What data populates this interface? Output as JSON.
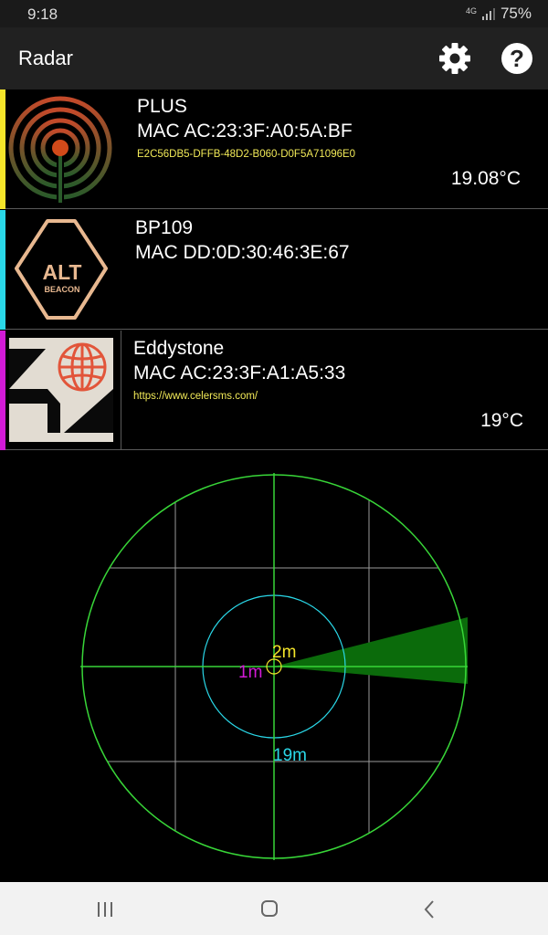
{
  "status": {
    "time": "9:18",
    "network": "4G",
    "battery": "75%"
  },
  "appbar": {
    "title": "Radar",
    "settings_icon": "gear-icon",
    "help_icon": "help-icon"
  },
  "devices": [
    {
      "name": "PLUS",
      "mac": "MAC AC:23:3F:A0:5A:BF",
      "uuid": "E2C56DB5-DFFB-48D2-B060-D0F5A71096E0",
      "temp": "19.08°C",
      "accent": "#f5e52a",
      "logo": "broadcast-beacon-logo"
    },
    {
      "name": "BP109",
      "mac": "MAC DD:0D:30:46:3E:67",
      "accent": "#2ad8e8",
      "logo": "altbeacon-logo",
      "logo_text": "ALT",
      "logo_subtext": "BEACON"
    },
    {
      "name": "Eddystone",
      "mac": "MAC AC:23:3F:A1:A5:33",
      "url": "https://www.celersms.com/",
      "temp": "19°C",
      "accent": "#d21ad6",
      "logo": "eddystone-logo"
    }
  ],
  "radar": {
    "labels": {
      "inner": "2m",
      "center": "1m",
      "outer": "19m"
    },
    "colors": {
      "outer_ring": "#38d638",
      "inner_ring": "#2ad8e8",
      "grid": "#9a9a9a",
      "sweep": "#0b6b0b",
      "inner_label": "#f5e52a",
      "center_label": "#d21ad6",
      "outer_label": "#2ad8e8"
    }
  },
  "navbar": {
    "recent_icon": "recent-apps-icon",
    "home_icon": "home-icon",
    "back_icon": "back-icon"
  }
}
